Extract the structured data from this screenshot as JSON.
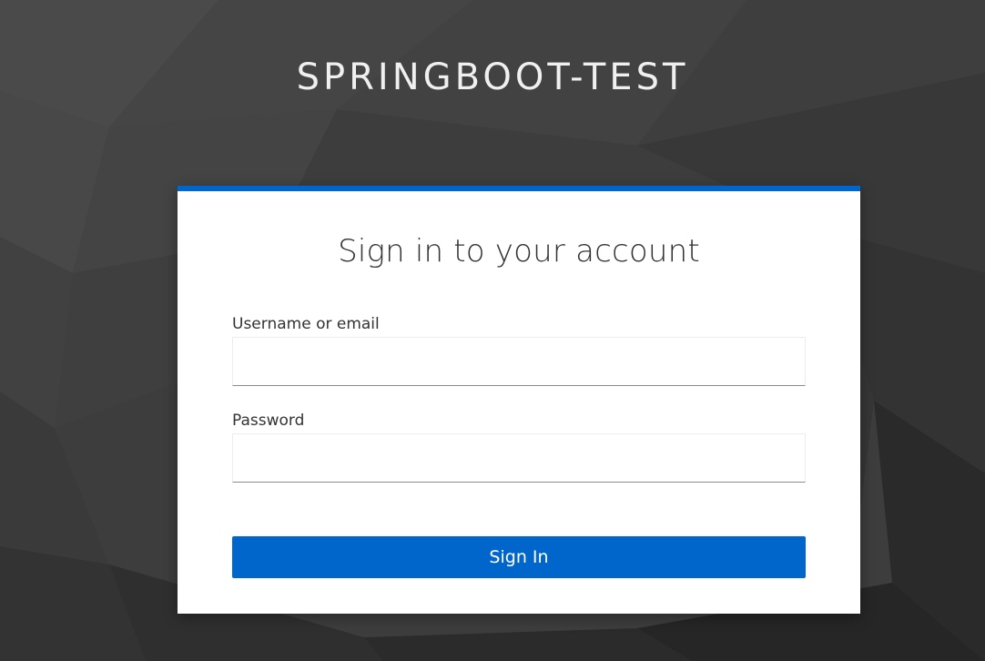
{
  "realm": {
    "title": "SPRINGBOOT-TEST"
  },
  "login": {
    "heading": "Sign in to your account",
    "username": {
      "label": "Username or email",
      "value": ""
    },
    "password": {
      "label": "Password",
      "value": ""
    },
    "submit_label": "Sign In"
  },
  "colors": {
    "accent": "#0066cc",
    "background": "#3a3a3a",
    "card": "#ffffff"
  }
}
